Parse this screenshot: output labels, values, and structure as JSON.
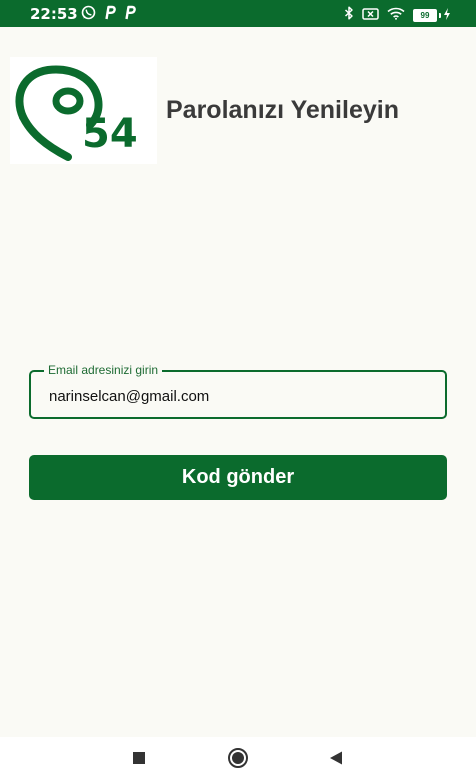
{
  "status_bar": {
    "time": "22:53",
    "battery_level": "99",
    "bg_color": "#0b6b2d"
  },
  "header": {
    "logo_icon": "location-pin-icon",
    "logo_number": "54",
    "title": "Parolanızı Yenileyin"
  },
  "form": {
    "email_label": "Email adresinizi girin",
    "email_value": "narinselcan@gmail.com",
    "submit_label": "Kod gönder"
  },
  "nav_bar": {
    "items": [
      "recents-square-icon",
      "home-circle-icon",
      "back-triangle-icon"
    ]
  },
  "colors": {
    "accent": "#0b6b2d",
    "background": "#fafaf5",
    "title": "#3a3a3a"
  }
}
